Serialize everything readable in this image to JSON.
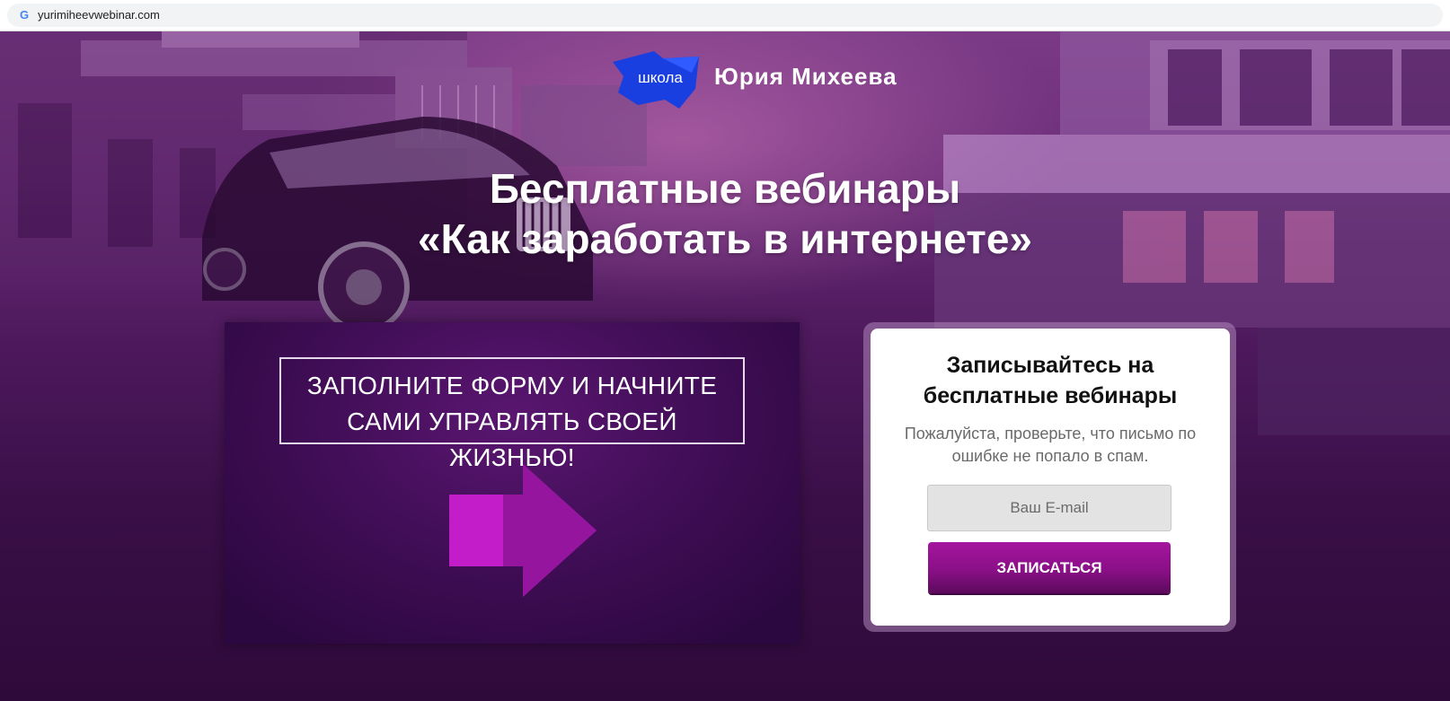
{
  "browser": {
    "url": "yurimiheevwebinar.com",
    "favicon": "google-g-icon"
  },
  "logo": {
    "school_label": "школа",
    "name": "Юрия Михеева",
    "mark_color": "#1a3fe0"
  },
  "hero": {
    "headline_line1": "Бесплатные вебинары",
    "headline_line2": "«Как заработать в интернете»"
  },
  "promo": {
    "line1": "ЗАПОЛНИТЕ ФОРМУ И НАЧНИТЕ",
    "line2": "САМИ УПРАВЛЯТЬ СВОЕЙ ЖИЗНЬЮ!",
    "icon": "arrow-right-icon",
    "arrow_color": "#c21dc8"
  },
  "form": {
    "title_line1": "Записывайтесь на",
    "title_line2": "бесплатные вебинары",
    "note_line1": "Пожалуйста, проверьте, что письмо по",
    "note_line2": "ошибке не попало в спам.",
    "email_placeholder": "Ваш E-mail",
    "email_value": "",
    "submit_label": "ЗАПИСАТЬСЯ",
    "button_color": "#8a0f87"
  }
}
